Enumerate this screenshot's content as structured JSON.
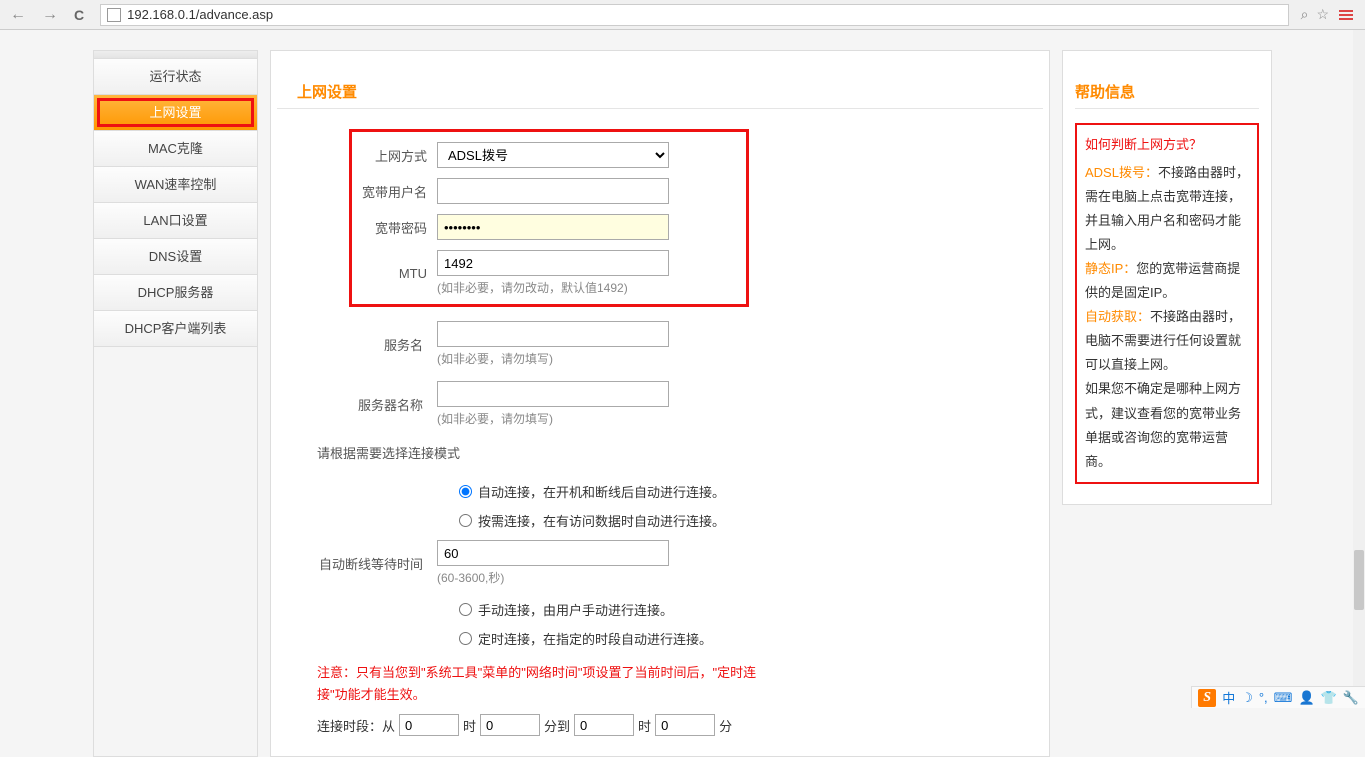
{
  "browser": {
    "url": "192.168.0.1/advance.asp"
  },
  "sidebar": {
    "items": [
      {
        "label": "运行状态"
      },
      {
        "label": "上网设置"
      },
      {
        "label": "MAC克隆"
      },
      {
        "label": "WAN速率控制"
      },
      {
        "label": "LAN口设置"
      },
      {
        "label": "DNS设置"
      },
      {
        "label": "DHCP服务器"
      },
      {
        "label": "DHCP客户端列表"
      }
    ]
  },
  "form": {
    "title": "上网设置",
    "conn_type_label": "上网方式",
    "conn_type_value": "ADSL拨号",
    "user_label": "宽带用户名",
    "user_value": "",
    "pass_label": "宽带密码",
    "pass_value": "••••••••",
    "mtu_label": "MTU",
    "mtu_value": "1492",
    "mtu_hint": "(如非必要，请勿改动，默认值1492)",
    "svc_label": "服务名",
    "svc_hint": "(如非必要，请勿填写)",
    "server_label": "服务器名称",
    "server_hint": "(如非必要，请勿填写)",
    "mode_prompt": "请根据需要选择连接模式",
    "radio_auto": "自动连接，在开机和断线后自动进行连接。",
    "radio_ondemand": "按需连接，在有访问数据时自动进行连接。",
    "idle_label": "自动断线等待时间",
    "idle_value": "60",
    "idle_hint": "(60-3600,秒)",
    "radio_manual": "手动连接，由用户手动进行连接。",
    "radio_sched": "定时连接，在指定的时段自动进行连接。",
    "warn": "注意：只有当您到\"系统工具\"菜单的\"网络时间\"项设置了当前时间后，\"定时连接\"功能才能生效。",
    "sched_prefix": "连接时段：从",
    "sched_h1": "0",
    "sched_m1": "0",
    "sched_h2": "0",
    "sched_m2": "0",
    "sched_hour": "时",
    "sched_min_to": "分到",
    "sched_min": "分"
  },
  "help": {
    "title": "帮助信息",
    "q": "如何判断上网方式？",
    "l1a": "ADSL拨号：",
    "l1b": "不接路由器时，需在电脑上点击宽带连接，并且输入用户名和密码才能上网。",
    "l2a": "静态IP：",
    "l2b": "您的宽带运营商提供的是固定IP。",
    "l3a": "自动获取：",
    "l3b": "不接路由器时，电脑不需要进行任何设置就可以直接上网。",
    "l4": "如果您不确定是哪种上网方式，建议查看您的宽带业务单据或咨询您的宽带运营商。"
  },
  "taskbar": {
    "cn": "中"
  }
}
